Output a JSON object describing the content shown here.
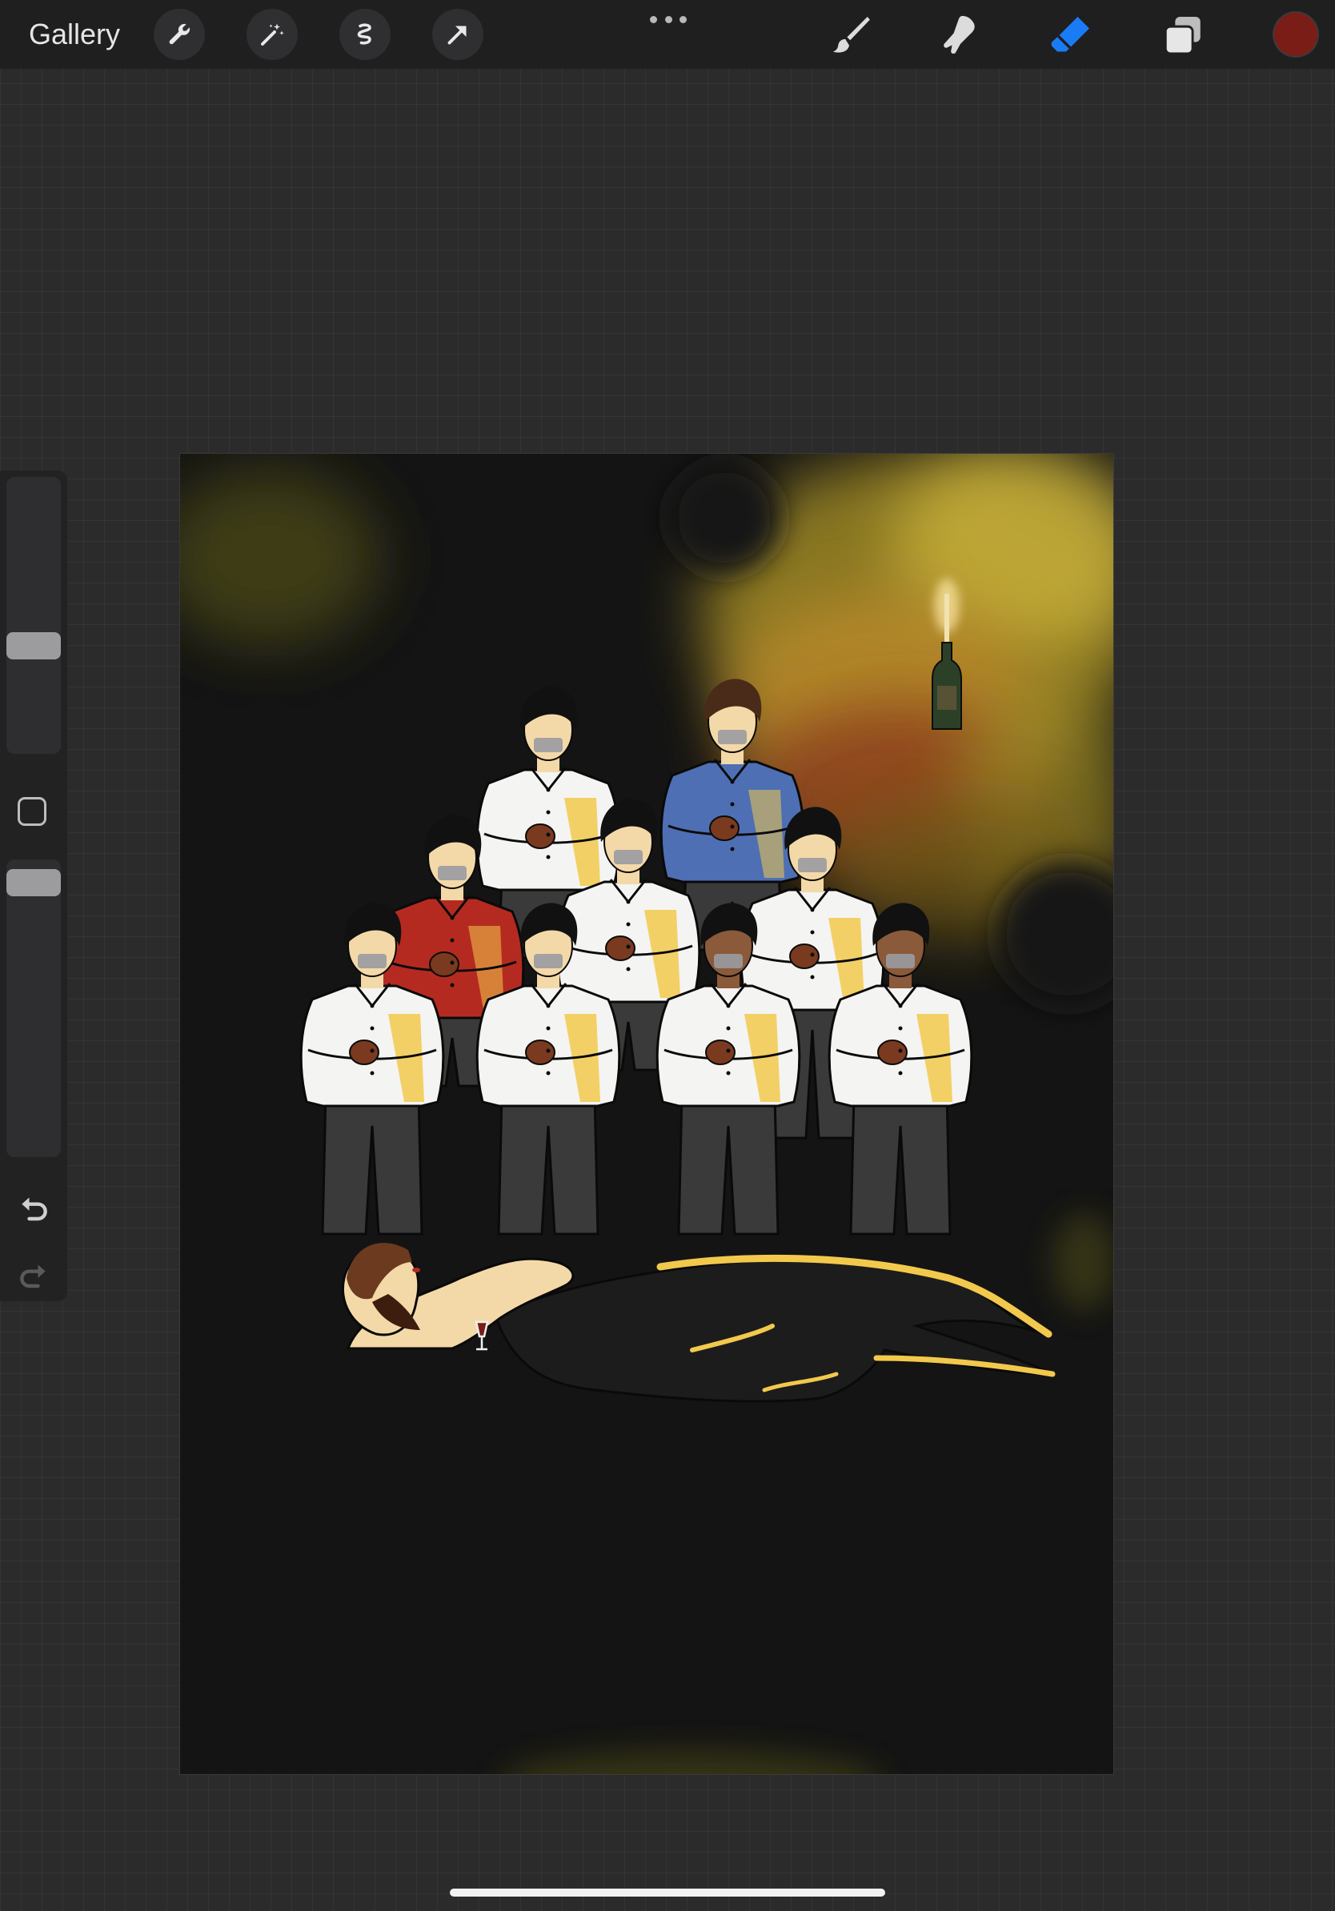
{
  "toolbar": {
    "gallery_label": "Gallery",
    "left_tools": [
      {
        "icon": "wrench-icon",
        "name": "actions"
      },
      {
        "icon": "magic-wand-icon",
        "name": "adjustments"
      },
      {
        "icon": "selection-icon",
        "name": "selection"
      },
      {
        "icon": "transform-arrow-icon",
        "name": "transform"
      }
    ],
    "right_tools": [
      {
        "icon": "brush-icon",
        "name": "paint"
      },
      {
        "icon": "smudge-icon",
        "name": "smudge"
      },
      {
        "icon": "eraser-icon",
        "name": "erase",
        "active": true
      },
      {
        "icon": "layers-icon",
        "name": "layers"
      }
    ],
    "active_tool_color": "#1a7cf5",
    "current_color": "#7a1d17"
  },
  "sidebar": {
    "brush_size_level": 0.35,
    "opacity_level": 0.55,
    "undo_icon": "undo-icon",
    "redo_icon": "redo-icon"
  },
  "artwork": {
    "background_color": "#141414",
    "glow_colors": [
      "#c9b13a",
      "#b8892b",
      "#8a3a1a"
    ],
    "shirt_colors": [
      "#f4f4f2",
      "#b52a20",
      "#4e6fb3"
    ],
    "pants_color": "#3a3a3a",
    "highlight_color": "#f2c94c"
  }
}
